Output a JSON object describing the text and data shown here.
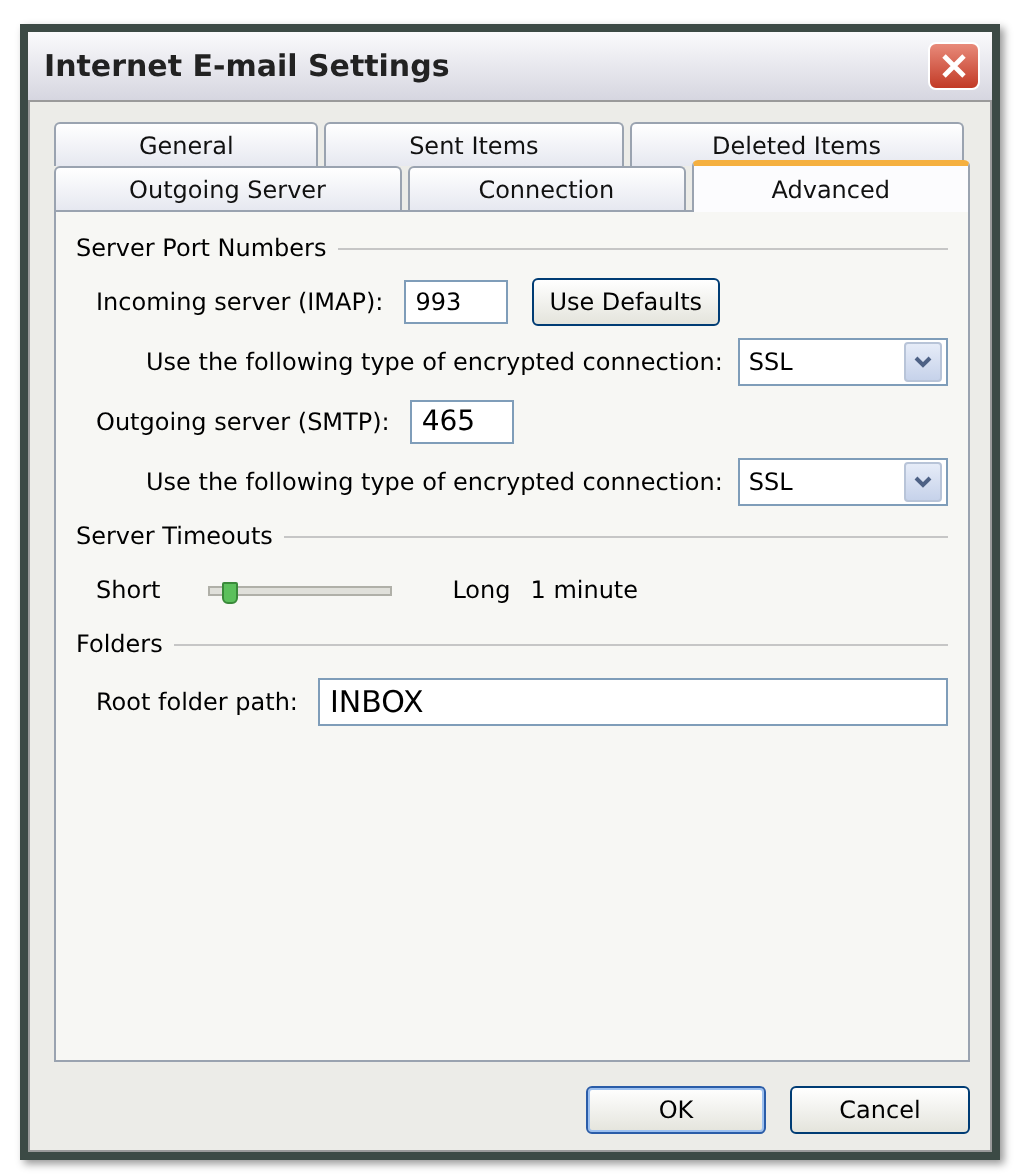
{
  "window": {
    "title": "Internet E-mail Settings"
  },
  "tab_rows": [
    [
      {
        "label": "General",
        "selected": false
      },
      {
        "label": "Sent Items",
        "selected": false
      },
      {
        "label": "Deleted Items",
        "selected": false
      }
    ],
    [
      {
        "label": "Outgoing Server",
        "selected": false
      },
      {
        "label": "Connection",
        "selected": false
      },
      {
        "label": "Advanced",
        "selected": true
      }
    ]
  ],
  "server_ports": {
    "heading": "Server Port Numbers",
    "incoming": {
      "label": "Incoming server (IMAP):",
      "value": "993"
    },
    "use_defaults": "Use Defaults",
    "incoming_encryption": {
      "label": "Use the following type of encrypted connection:",
      "value": "SSL"
    },
    "outgoing": {
      "label": "Outgoing server (SMTP):",
      "value": "465"
    },
    "outgoing_encryption": {
      "label": "Use the following type of encrypted connection:",
      "value": "SSL"
    }
  },
  "timeouts": {
    "heading": "Server Timeouts",
    "short": "Short",
    "long": "Long",
    "level": 0.1,
    "reading": "1 minute"
  },
  "folders": {
    "heading": "Folders",
    "root_label": "Root folder path:",
    "root_value": "INBOX"
  },
  "buttons": [
    "OK",
    "Cancel"
  ]
}
